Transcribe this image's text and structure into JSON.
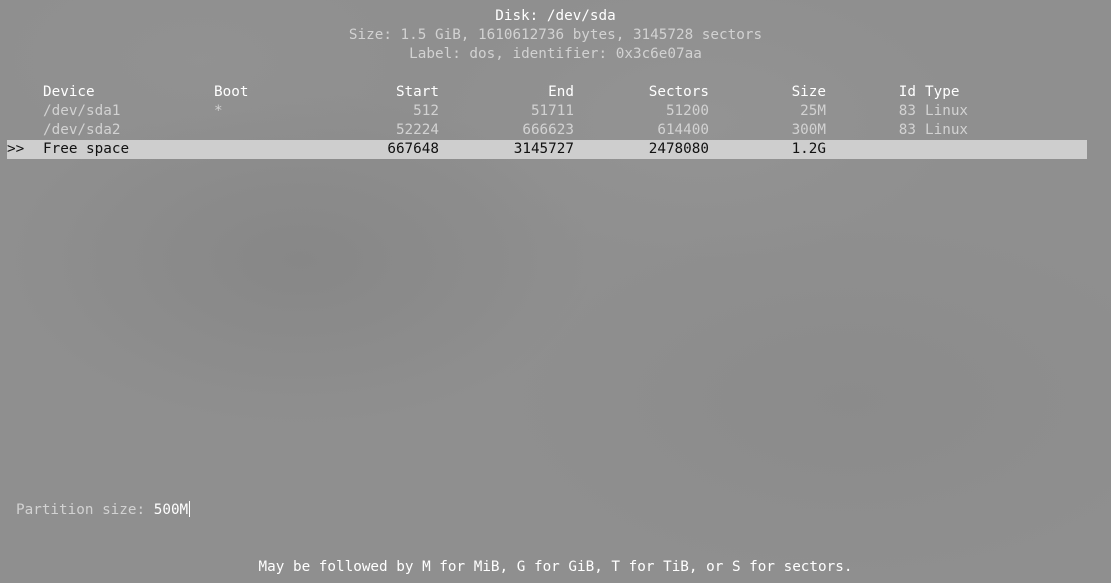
{
  "disk": {
    "title": "Disk: /dev/sda",
    "size_line": "Size: 1.5 GiB, 1610612736 bytes, 3145728 sectors",
    "label_line": "Label: dos, identifier: 0x3c6e07aa"
  },
  "table": {
    "columns": {
      "device": "Device",
      "boot": "Boot",
      "start": "Start",
      "end": "End",
      "sectors": "Sectors",
      "size": "Size",
      "id": "Id",
      "type": "Type"
    },
    "rows": [
      {
        "cursor": "",
        "device": "/dev/sda1",
        "boot": "*",
        "start": "512",
        "end": "51711",
        "sectors": "51200",
        "size": "25M",
        "id": "83",
        "type": "Linux"
      },
      {
        "cursor": "",
        "device": "/dev/sda2",
        "boot": "",
        "start": "52224",
        "end": "666623",
        "sectors": "614400",
        "size": "300M",
        "id": "83",
        "type": "Linux"
      },
      {
        "cursor": ">>",
        "device": "Free space",
        "boot": "",
        "start": "667648",
        "end": "3145727",
        "sectors": "2478080",
        "size": "1.2G",
        "id": "",
        "type": ""
      }
    ]
  },
  "prompt": {
    "label": "Partition size: ",
    "value": "500M"
  },
  "hint": "May be followed by M for MiB, G for GiB, T for TiB, or S for sectors."
}
